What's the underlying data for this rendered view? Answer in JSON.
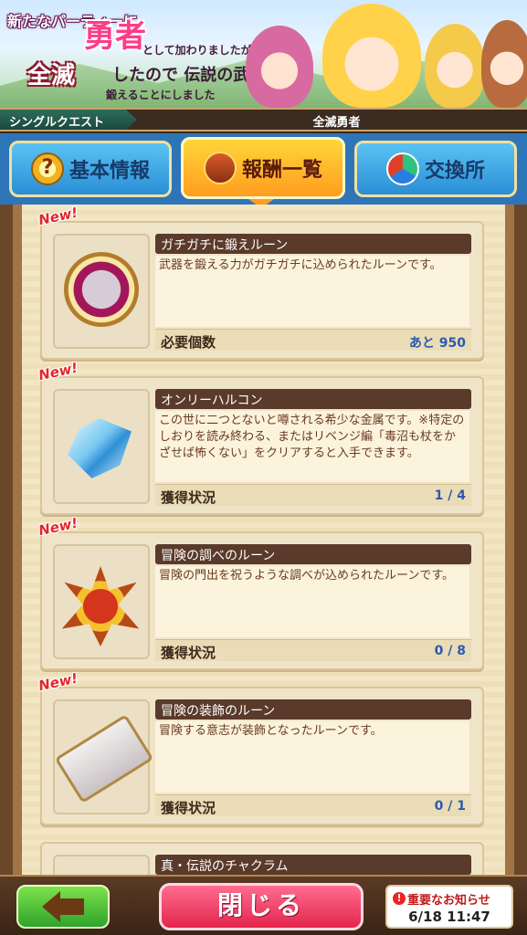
{
  "banner": {
    "line1": "新たなパーティーに",
    "big1": "勇者",
    "line2": "として加わりましたが",
    "big2": "全滅",
    "line3": "したので 伝説の武器を",
    "line4": "鍛えることにしました"
  },
  "quest_bar": {
    "tag": "シングルクエスト",
    "title": "全滅勇者"
  },
  "tabs": [
    {
      "label": "基本情報",
      "icon": "question-icon",
      "active": false
    },
    {
      "label": "報酬一覧",
      "icon": "treasure-chest-icon",
      "active": true
    },
    {
      "label": "交換所",
      "icon": "exchange-icon",
      "active": false
    }
  ],
  "rewards": [
    {
      "new_label": "New!",
      "name": "ガチガチに鍛えルーン",
      "description": "武器を鍛える力がガチガチに込められたルーンです。",
      "status_label": "必要個数",
      "status_value": "あと 950",
      "icon": "hammer-rune-icon"
    },
    {
      "new_label": "New!",
      "name": "オンリーハルコン",
      "description": "この世に二つとないと噂される希少な金属です。※特定のしおりを読み終わる、またはリベンジ編「毒沼も杖をかざせば怖くない」をクリアすると入手できます。",
      "status_label": "獲得状況",
      "status_value": "1 / 4",
      "icon": "crystal-icon"
    },
    {
      "new_label": "New!",
      "name": "冒険の調べのルーン",
      "description": "冒険の門出を祝うような調べが込められたルーンです。",
      "status_label": "獲得状況",
      "status_value": "0 / 8",
      "icon": "star-emblem-icon"
    },
    {
      "new_label": "New!",
      "name": "冒険の装飾のルーン",
      "description": "冒険する意志が装飾となったルーンです。",
      "status_label": "獲得状況",
      "status_value": "0 / 1",
      "icon": "card-rune-icon"
    },
    {
      "new_label": "",
      "name": "真・伝説のチャクラム",
      "description": "",
      "status_label": "",
      "status_value": "",
      "icon": ""
    }
  ],
  "bottom": {
    "close_label": "閉じる",
    "news_title": "重要なお知らせ",
    "news_date": "6/18 11:47",
    "alert_symbol": "!"
  }
}
